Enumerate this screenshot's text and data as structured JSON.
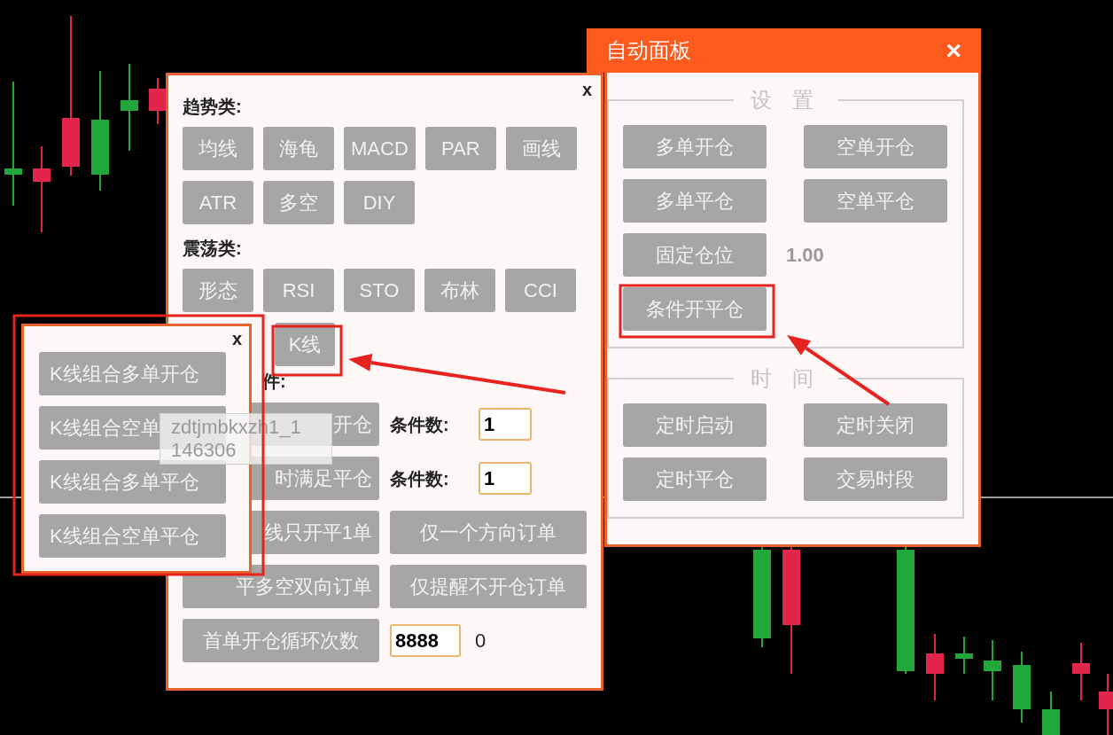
{
  "indicator_panel": {
    "close": "x",
    "groups": [
      {
        "title": "趋势类:",
        "rows": [
          [
            "均线",
            "海龟",
            "MACD",
            "PAR",
            "画线"
          ],
          [
            "ATR",
            "多空",
            "DIY"
          ]
        ]
      },
      {
        "title": "震荡类:",
        "rows": [
          [
            "形态",
            "RSI",
            "STO",
            "布林",
            "CCI"
          ],
          []
        ]
      }
    ],
    "oscillator_extra": {
      "label": "K线",
      "clipped": true
    },
    "condition_title": {
      "text": "件:",
      "clipped": true
    },
    "condition_rows": [
      [
        {
          "kind": "button",
          "label": "开仓",
          "clipped": true
        },
        {
          "kind": "label",
          "text": "条件数:"
        },
        {
          "kind": "input",
          "value": "1"
        }
      ],
      [
        {
          "kind": "button",
          "label": "时满足平仓",
          "clipped": true
        },
        {
          "kind": "label",
          "text": "条件数:"
        },
        {
          "kind": "input",
          "value": "1"
        }
      ],
      [
        {
          "kind": "button",
          "label": "线只开平1单",
          "clipped": true
        },
        {
          "kind": "button",
          "label": "仅一个方向订单",
          "clipped": false
        }
      ],
      [
        {
          "kind": "button",
          "label": "平多空双向订单",
          "clipped": true
        },
        {
          "kind": "button",
          "label": "仅提醒不开仓订单",
          "clipped": false
        }
      ],
      [
        {
          "kind": "button",
          "label": "首单开仓循环次数",
          "clipped": false
        },
        {
          "kind": "input",
          "value": "8888"
        },
        {
          "kind": "value",
          "text": "0"
        }
      ]
    ]
  },
  "auto_panel": {
    "title": "自动面板",
    "close": "×",
    "sections": [
      {
        "title": "设 置",
        "rows": [
          [
            {
              "kind": "button",
              "label": "多单开仓"
            },
            {
              "kind": "button",
              "label": "空单开仓"
            }
          ],
          [
            {
              "kind": "button",
              "label": "多单平仓"
            },
            {
              "kind": "button",
              "label": "空单平仓"
            }
          ],
          [
            {
              "kind": "button",
              "label": "固定仓位"
            },
            {
              "kind": "value",
              "text": "1.00"
            }
          ],
          [
            {
              "kind": "button",
              "label": "条件开平仓"
            }
          ]
        ]
      },
      {
        "title": "时 间",
        "rows": [
          [
            {
              "kind": "button",
              "label": "定时启动"
            },
            {
              "kind": "button",
              "label": "定时关闭"
            }
          ],
          [
            {
              "kind": "button",
              "label": "定时平仓"
            },
            {
              "kind": "button",
              "label": "交易时段"
            }
          ]
        ]
      }
    ]
  },
  "kline_popup": {
    "close": "x",
    "buttons": [
      "K线组合多单开仓",
      "K线组合空单",
      "K线组合多单平仓",
      "K线组合空单平仓"
    ]
  },
  "tooltip": {
    "lines": [
      "zdtjmbkxzh1_1",
      "146306"
    ]
  }
}
